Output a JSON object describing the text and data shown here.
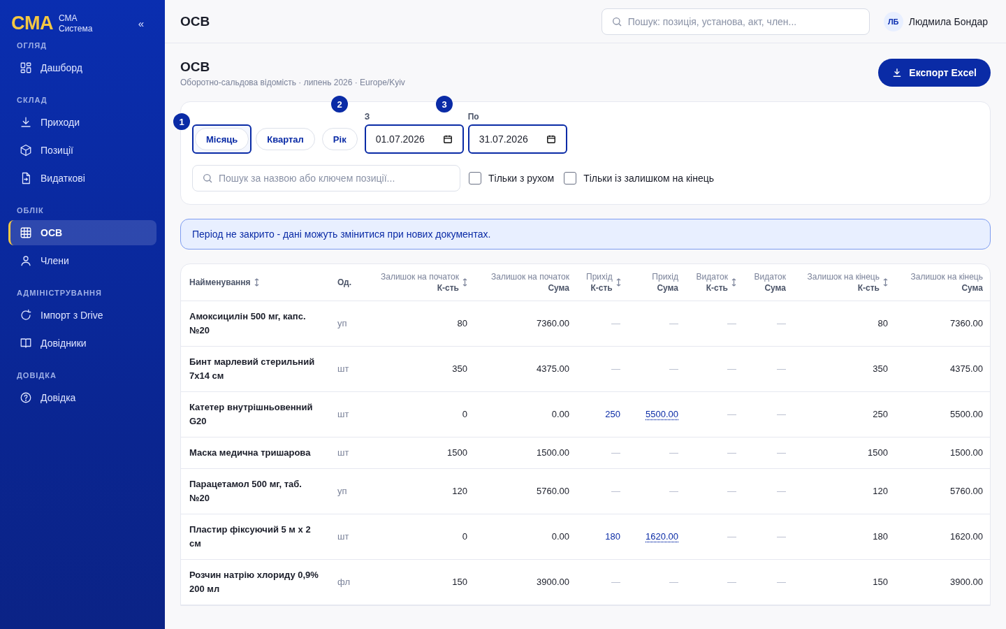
{
  "sidebar": {
    "logo": "CMA",
    "brand_line_1": "СМА",
    "brand_line_2": "Система",
    "collapse": "«",
    "sections": [
      {
        "title": "ОГЛЯД",
        "items": [
          {
            "label": "Дашборд",
            "selected": false
          }
        ]
      },
      {
        "title": "СКЛАД",
        "items": [
          {
            "label": "Приходи",
            "selected": false
          },
          {
            "label": "Позиції",
            "selected": false
          },
          {
            "label": "Видаткові",
            "selected": false
          }
        ]
      },
      {
        "title": "ОБЛІК",
        "items": [
          {
            "label": "ОСВ",
            "selected": true
          },
          {
            "label": "Члени",
            "selected": false
          }
        ]
      },
      {
        "title": "АДМІНІСТРУВАННЯ",
        "items": [
          {
            "label": "Імпорт з Drive",
            "selected": false
          },
          {
            "label": "Довідники",
            "selected": false
          }
        ]
      },
      {
        "title": "ДОВІДКА",
        "items": [
          {
            "label": "Довідка",
            "selected": false
          }
        ]
      }
    ]
  },
  "topbar": {
    "title": "ОСВ",
    "search": {
      "placeholder": "Пошук: позиція, установа, акт, член..."
    },
    "user": {
      "initials": "ЛБ",
      "name": "Людмила Бондар"
    }
  },
  "page": {
    "title": "ОСВ",
    "subtitle": "Оборотно-сальдова відомість · липень 2026 · Europe/Kyiv",
    "export_button": "Експорт Excel"
  },
  "filters": {
    "markers": [
      "1",
      "2",
      "3"
    ],
    "periods": [
      {
        "label": "Місяць",
        "selected": true
      },
      {
        "label": "Квартал",
        "selected": false
      },
      {
        "label": "Рік",
        "selected": false
      }
    ],
    "date_from": {
      "label": "З",
      "value": "01.07.2026"
    },
    "date_to": {
      "label": "По",
      "value": "31.07.2026"
    },
    "search": {
      "placeholder": "Пошук за назвою або ключем позиції..."
    },
    "checkboxes": [
      {
        "label": "Тільки з рухом",
        "checked": false
      },
      {
        "label": "Тільки із залишком на кінець",
        "checked": false
      }
    ]
  },
  "notice": "Період не закрито - дані можуть змінитися при нових документах.",
  "table": {
    "columns": [
      {
        "label": "Найменування",
        "sortable": true
      },
      {
        "label": "Од.",
        "sortable": false
      },
      {
        "group": "Залишок на початок",
        "label": "К-сть",
        "sortable": true
      },
      {
        "group": "Залишок на початок",
        "label": "Сума",
        "sortable": false
      },
      {
        "group": "Прихід",
        "label": "К-сть",
        "sortable": true
      },
      {
        "group": "Прихід",
        "label": "Сума",
        "sortable": false
      },
      {
        "group": "Видаток",
        "label": "К-сть",
        "sortable": true
      },
      {
        "group": "Видаток",
        "label": "Сума",
        "sortable": false
      },
      {
        "group": "Залишок на кінець",
        "label": "К-сть",
        "sortable": true
      },
      {
        "group": "Залишок на кінець",
        "label": "Сума",
        "sortable": false
      }
    ],
    "rows": [
      {
        "cells": [
          {
            "text": "Амоксицилін 500 мг, капс. №20",
            "kind": "name"
          },
          {
            "text": "уп",
            "kind": "unit"
          },
          {
            "text": "80",
            "kind": "num"
          },
          {
            "text": "7360.00",
            "kind": "num"
          },
          {
            "text": "—",
            "kind": "dash"
          },
          {
            "text": "—",
            "kind": "dash"
          },
          {
            "text": "—",
            "kind": "dash"
          },
          {
            "text": "—",
            "kind": "dash"
          },
          {
            "text": "80",
            "kind": "num"
          },
          {
            "text": "7360.00",
            "kind": "num"
          }
        ]
      },
      {
        "cells": [
          {
            "text": "Бинт марлевий стерильний 7х14 см",
            "kind": "name"
          },
          {
            "text": "шт",
            "kind": "unit"
          },
          {
            "text": "350",
            "kind": "num"
          },
          {
            "text": "4375.00",
            "kind": "num"
          },
          {
            "text": "—",
            "kind": "dash"
          },
          {
            "text": "—",
            "kind": "dash"
          },
          {
            "text": "—",
            "kind": "dash"
          },
          {
            "text": "—",
            "kind": "dash"
          },
          {
            "text": "350",
            "kind": "num"
          },
          {
            "text": "4375.00",
            "kind": "num"
          }
        ]
      },
      {
        "cells": [
          {
            "text": "Катетер внутрішньовенний G20",
            "kind": "name"
          },
          {
            "text": "шт",
            "kind": "unit"
          },
          {
            "text": "0",
            "kind": "num"
          },
          {
            "text": "0.00",
            "kind": "num"
          },
          {
            "text": "250",
            "kind": "link"
          },
          {
            "text": "5500.00",
            "kind": "dotted-link"
          },
          {
            "text": "—",
            "kind": "dash"
          },
          {
            "text": "—",
            "kind": "dash"
          },
          {
            "text": "250",
            "kind": "num"
          },
          {
            "text": "5500.00",
            "kind": "num"
          }
        ]
      },
      {
        "cells": [
          {
            "text": "Маска медична тришарова",
            "kind": "name"
          },
          {
            "text": "шт",
            "kind": "unit"
          },
          {
            "text": "1500",
            "kind": "num"
          },
          {
            "text": "1500.00",
            "kind": "num"
          },
          {
            "text": "—",
            "kind": "dash"
          },
          {
            "text": "—",
            "kind": "dash"
          },
          {
            "text": "—",
            "kind": "dash"
          },
          {
            "text": "—",
            "kind": "dash"
          },
          {
            "text": "1500",
            "kind": "num"
          },
          {
            "text": "1500.00",
            "kind": "num"
          }
        ]
      },
      {
        "cells": [
          {
            "text": "Парацетамол 500 мг, таб. №20",
            "kind": "name"
          },
          {
            "text": "уп",
            "kind": "unit"
          },
          {
            "text": "120",
            "kind": "num"
          },
          {
            "text": "5760.00",
            "kind": "num"
          },
          {
            "text": "—",
            "kind": "dash"
          },
          {
            "text": "—",
            "kind": "dash"
          },
          {
            "text": "—",
            "kind": "dash"
          },
          {
            "text": "—",
            "kind": "dash"
          },
          {
            "text": "120",
            "kind": "num"
          },
          {
            "text": "5760.00",
            "kind": "num"
          }
        ]
      },
      {
        "cells": [
          {
            "text": "Пластир фіксуючий 5 м х 2 см",
            "kind": "name"
          },
          {
            "text": "шт",
            "kind": "unit"
          },
          {
            "text": "0",
            "kind": "num"
          },
          {
            "text": "0.00",
            "kind": "num"
          },
          {
            "text": "180",
            "kind": "link"
          },
          {
            "text": "1620.00",
            "kind": "dotted-link"
          },
          {
            "text": "—",
            "kind": "dash"
          },
          {
            "text": "—",
            "kind": "dash"
          },
          {
            "text": "180",
            "kind": "num"
          },
          {
            "text": "1620.00",
            "kind": "num"
          }
        ]
      },
      {
        "cells": [
          {
            "text": "Розчин натрію хлориду 0,9% 200 мл",
            "kind": "name"
          },
          {
            "text": "фл",
            "kind": "unit"
          },
          {
            "text": "150",
            "kind": "num"
          },
          {
            "text": "3900.00",
            "kind": "num"
          },
          {
            "text": "—",
            "kind": "dash"
          },
          {
            "text": "—",
            "kind": "dash"
          },
          {
            "text": "—",
            "kind": "dash"
          },
          {
            "text": "—",
            "kind": "dash"
          },
          {
            "text": "150",
            "kind": "num"
          },
          {
            "text": "3900.00",
            "kind": "num"
          }
        ]
      }
    ]
  }
}
